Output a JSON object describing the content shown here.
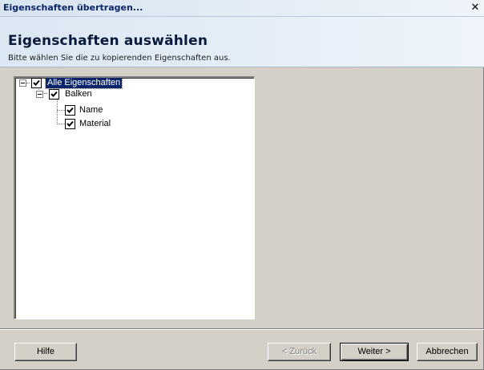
{
  "window": {
    "title": "Eigenschaften übertragen..."
  },
  "header": {
    "title": "Eigenschaften auswählen",
    "subtitle": "Bitte wählen Sie die zu kopierenden Eigenschaften aus."
  },
  "tree": {
    "root": {
      "label": "Alle Eigenschaften",
      "checked": true,
      "selected": true,
      "expanded": true
    },
    "group": {
      "label": "Balken",
      "checked": true,
      "expanded": true
    },
    "items": [
      {
        "label": "Name",
        "checked": true
      },
      {
        "label": "Material",
        "checked": true
      }
    ]
  },
  "buttons": {
    "help": "Hilfe",
    "back": "< Zurück",
    "next": "Weiter >",
    "cancel": "Abbrechen"
  },
  "icons": {
    "close": "close-icon",
    "expander": "collapse-icon",
    "checkbox": "checkmark-icon"
  }
}
